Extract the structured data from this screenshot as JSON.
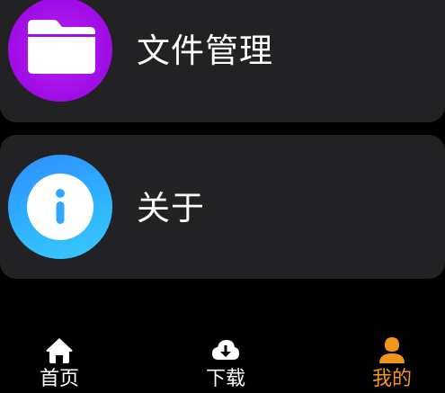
{
  "menu": {
    "items": [
      {
        "label": "文件管理",
        "icon": "folder-icon",
        "color": "#a80ee8"
      },
      {
        "label": "关于",
        "icon": "info-icon",
        "color": "#2fa6ff"
      }
    ]
  },
  "tabbar": {
    "tabs": [
      {
        "label": "首页",
        "icon": "home-icon",
        "active": false
      },
      {
        "label": "下载",
        "icon": "cloud-download-icon",
        "active": false
      },
      {
        "label": "我的",
        "icon": "person-icon",
        "active": true
      }
    ],
    "active_color": "#f0961c",
    "inactive_color": "#ffffff"
  }
}
